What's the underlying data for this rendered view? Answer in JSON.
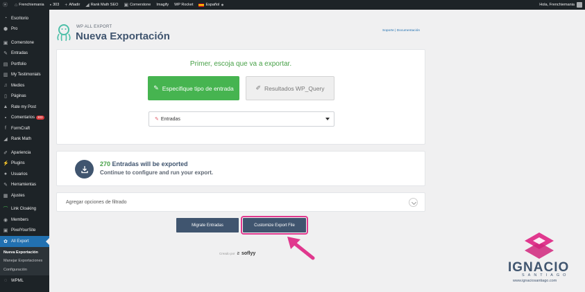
{
  "admin_bar": {
    "site_name": "Frenchiemania",
    "comments_count": "303",
    "add_new": "Añadir",
    "rank_math": "Rank Math SEO",
    "cornerstone": "Cornerstone",
    "imagify": "Imagify",
    "wp_rocket": "WP Rocket",
    "language": "Español",
    "greeting": "Hola, Frenchiemania"
  },
  "sidebar": {
    "items": [
      {
        "label": "Escritorio",
        "icon": "dashboard-icon"
      },
      {
        "label": "Pro",
        "icon": "pro-icon"
      },
      {
        "label": "Cornerstone",
        "icon": "cornerstone-icon"
      },
      {
        "label": "Entradas",
        "icon": "pin-icon"
      },
      {
        "label": "Portfolio",
        "icon": "portfolio-icon"
      },
      {
        "label": "My Testimonials",
        "icon": "testimonials-icon"
      },
      {
        "label": "Medios",
        "icon": "media-icon"
      },
      {
        "label": "Páginas",
        "icon": "pages-icon"
      },
      {
        "label": "Rate my Post",
        "icon": "thumbs-up-icon"
      },
      {
        "label": "Comentarios",
        "icon": "comments-icon",
        "badge": "303"
      },
      {
        "label": "FormCraft",
        "icon": "formcraft-icon"
      },
      {
        "label": "Rank Math",
        "icon": "rank-math-icon"
      },
      {
        "label": "Apariencia",
        "icon": "appearance-icon"
      },
      {
        "label": "Plugins",
        "icon": "plugins-icon"
      },
      {
        "label": "Usuarios",
        "icon": "users-icon"
      },
      {
        "label": "Herramientas",
        "icon": "tools-icon"
      },
      {
        "label": "Ajustes",
        "icon": "settings-icon"
      },
      {
        "label": "Link Cloaking",
        "icon": "link-icon"
      },
      {
        "label": "Members",
        "icon": "members-icon"
      },
      {
        "label": "PixelYourSite",
        "icon": "pixel-icon"
      },
      {
        "label": "All Export",
        "icon": "all-export-icon"
      }
    ],
    "submenu": [
      "Nueva Exportación",
      "Manejar Exportaciones",
      "Configuración"
    ],
    "last_item": "WPML"
  },
  "header": {
    "brand_small": "WP ALL EXPORT",
    "title": "Nueva Exportación",
    "links": "Soporte | Documentación"
  },
  "step1": {
    "prompt": "Primer, escoja que va a exportar.",
    "btn_type": "Especifique tipo de entrada",
    "btn_query": "Resultados WP_Query",
    "selected_post_type": "Entradas"
  },
  "summary": {
    "count": "270",
    "count_text": "Entradas will be exported",
    "subtext": "Continue to configure and run your export."
  },
  "filter": {
    "label": "Agregar opciones de filtrado"
  },
  "actions": {
    "migrate": "Migrate Entradas",
    "customize": "Customize Export File"
  },
  "footer": {
    "created_by": "Creado por",
    "brand": "soflyy"
  },
  "watermark": {
    "name": "IGNACIO",
    "sub": "SANTIAGO",
    "url": "www.ignaciosantiago.com"
  },
  "colors": {
    "admin_dark": "#1d2327",
    "accent_blue": "#2271b1",
    "green": "#46b450",
    "navy": "#40556f",
    "highlight_pink": "#e0388e"
  }
}
